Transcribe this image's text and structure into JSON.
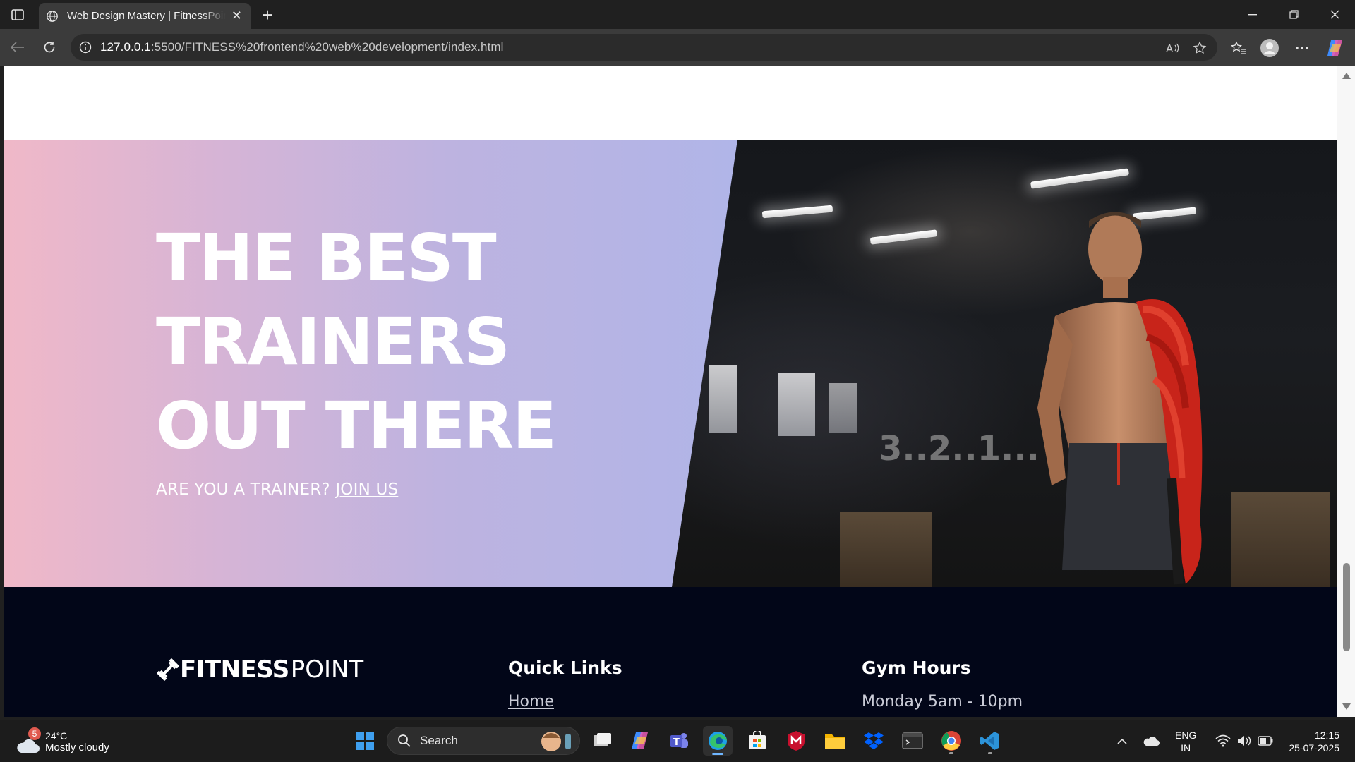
{
  "browser": {
    "tab_title": "Web Design Mastery | FitnessPoint",
    "url_host": "127.0.0.1",
    "url_path": ":5500/FITNESS%20frontend%20web%20development/index.html"
  },
  "hero": {
    "headline_line1": "THE BEST",
    "headline_line2": "TRAINERS",
    "headline_line3": "OUT THERE",
    "cta_text": "ARE YOU A TRAINER?",
    "cta_link": "JOIN US",
    "wall_mark": "3..2..1..."
  },
  "footer": {
    "logo_bold": "FITNESS",
    "logo_light": "POINT",
    "quick_links_title": "Quick Links",
    "quick_links": [
      "Home"
    ],
    "gym_hours_title": "Gym Hours",
    "gym_hours": [
      "Monday 5am - 10pm"
    ]
  },
  "taskbar": {
    "weather_badge": "5",
    "weather_temp": "24°C",
    "weather_desc": "Mostly cloudy",
    "search_label": "Search",
    "lang_line1": "ENG",
    "lang_line2": "IN",
    "time": "12:15",
    "date": "25-07-2025"
  },
  "colors": {
    "gradient_start": "#f0b8c8",
    "gradient_end": "#b0b5e8",
    "footer_bg": "#020618",
    "browser_accent": "#3b3b3b"
  }
}
